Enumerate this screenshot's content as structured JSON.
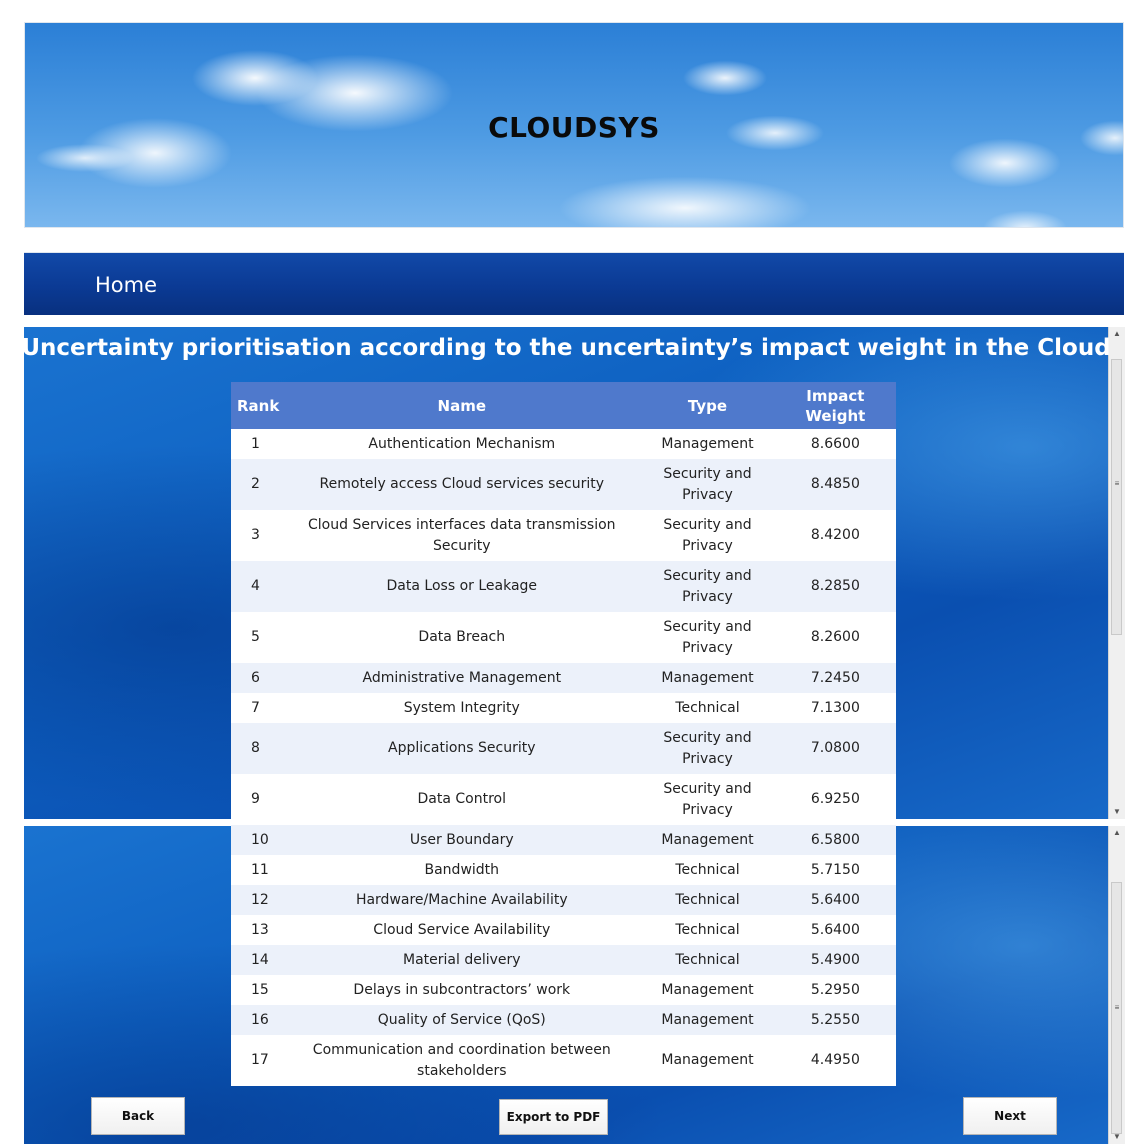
{
  "header": {
    "title": "CLOUDSYS"
  },
  "nav": {
    "home_label": "Home"
  },
  "page": {
    "heading": "Uncertainty prioritisation according to the uncertainty’s impact weight in the Cloud"
  },
  "table": {
    "columns": {
      "rank": "Rank",
      "name": "Name",
      "type": "Type",
      "impact_weight": "Impact Weight"
    },
    "rows": [
      {
        "rank": "1",
        "name": "Authentication Mechanism",
        "type": "Management",
        "weight": "8.6600"
      },
      {
        "rank": "2",
        "name": "Remotely access Cloud services security",
        "type": "Security and Privacy",
        "weight": "8.4850"
      },
      {
        "rank": "3",
        "name": "Cloud Services interfaces data transmission Security",
        "type": "Security and Privacy",
        "weight": "8.4200"
      },
      {
        "rank": "4",
        "name": "Data Loss or Leakage",
        "type": "Security and Privacy",
        "weight": "8.2850"
      },
      {
        "rank": "5",
        "name": "Data Breach",
        "type": "Security and Privacy",
        "weight": "8.2600"
      },
      {
        "rank": "6",
        "name": "Administrative Management",
        "type": "Management",
        "weight": "7.2450"
      },
      {
        "rank": "7",
        "name": "System Integrity",
        "type": "Technical",
        "weight": "7.1300"
      },
      {
        "rank": "8",
        "name": "Applications Security",
        "type": "Security and Privacy",
        "weight": "7.0800"
      },
      {
        "rank": "9",
        "name": "Data Control",
        "type": "Security and Privacy",
        "weight": "6.9250"
      },
      {
        "rank": "10",
        "name": "User Boundary",
        "type": "Management",
        "weight": "6.5800"
      },
      {
        "rank": "11",
        "name": "Bandwidth",
        "type": "Technical",
        "weight": "5.7150"
      },
      {
        "rank": "12",
        "name": "Hardware/Machine Availability",
        "type": "Technical",
        "weight": "5.6400"
      },
      {
        "rank": "13",
        "name": "Cloud Service Availability",
        "type": "Technical",
        "weight": "5.6400"
      },
      {
        "rank": "14",
        "name": "Material delivery",
        "type": "Technical",
        "weight": "5.4900"
      },
      {
        "rank": "15",
        "name": "Delays in subcontractors’ work",
        "type": "Management",
        "weight": "5.2950"
      },
      {
        "rank": "16",
        "name": "Quality of Service (QoS)",
        "type": "Management",
        "weight": "5.2550"
      },
      {
        "rank": "17",
        "name": "Communication and coordination between stakeholders",
        "type": "Management",
        "weight": "4.4950"
      }
    ]
  },
  "buttons": {
    "back": "Back",
    "export": "Export to PDF",
    "next": "Next"
  },
  "icons": {
    "scroll_up": "scroll-up-arrow-icon",
    "scroll_down": "scroll-down-arrow-icon",
    "grip": "scrollbar-grip-icon"
  }
}
